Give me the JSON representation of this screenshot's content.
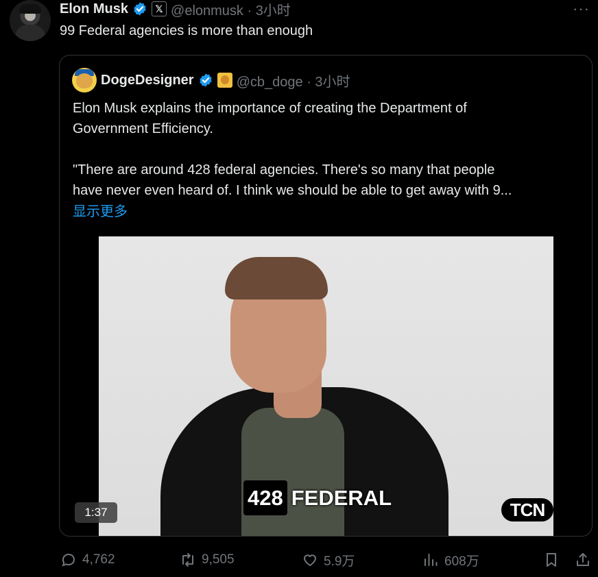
{
  "author": {
    "name": "Elon Musk",
    "handle_time": "@elonmusk · 3小时",
    "xbadge": "𝕏",
    "menu": "···"
  },
  "tweet": {
    "text": "99 Federal agencies is more than enough"
  },
  "quote": {
    "name": "DogeDesigner",
    "handle_time": "@cb_doge · 3小时",
    "line1": "Elon Musk explains the importance of creating the Department of",
    "line2": "Government Efficiency.",
    "line3": "\"There are around 428 federal agencies. There's so many that people",
    "line4": "have never even heard of. I think we should be able to get away with 9...",
    "show_more": "显示更多",
    "video": {
      "caption_number": "428",
      "caption_word": "FEDERAL",
      "watermark": "TCN",
      "duration": "1:37"
    }
  },
  "actions": {
    "replies": "4,762",
    "reposts": "9,505",
    "likes": "5.9万",
    "views": "608万"
  },
  "colors": {
    "accent": "#1d9bf0",
    "muted": "#71767b",
    "text": "#e7e9ea",
    "background": "#000000"
  }
}
